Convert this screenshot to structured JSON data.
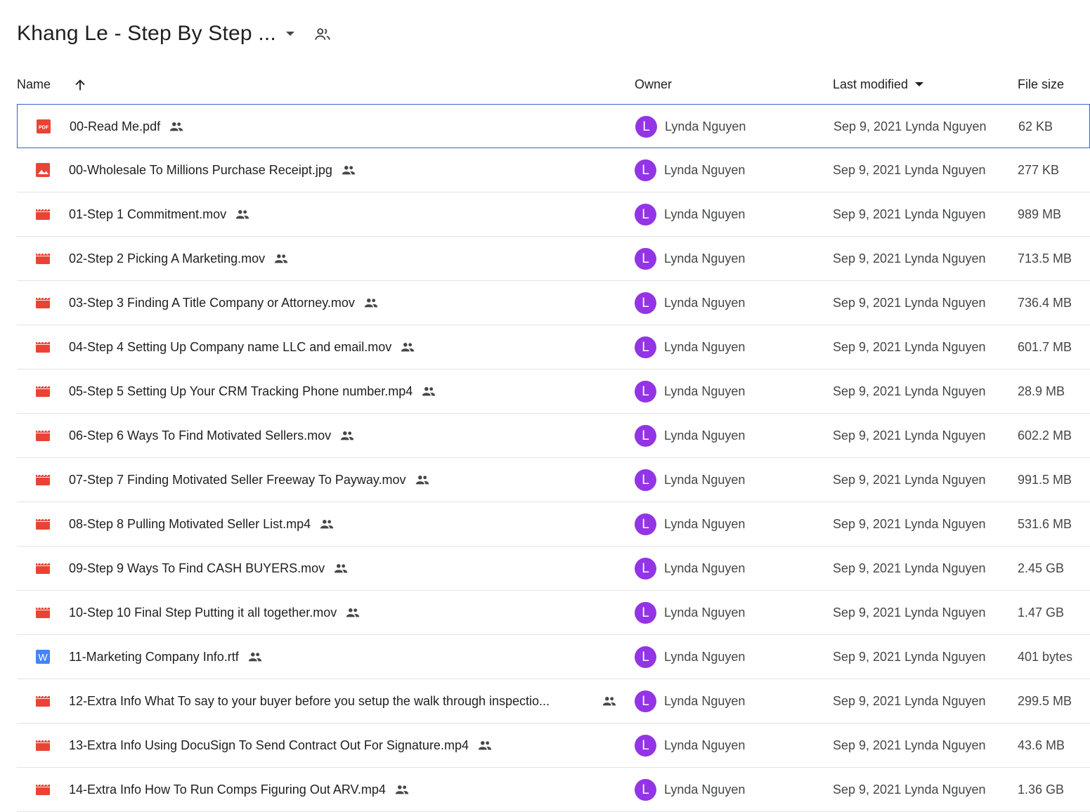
{
  "header": {
    "title": "Khang Le - Step By Step ...",
    "shared_icon": "people-icon",
    "dropdown_icon": "caret-down-icon"
  },
  "columns": {
    "name": "Name",
    "name_sort_icon": "arrow-up-icon",
    "owner": "Owner",
    "last_modified": "Last modified",
    "last_modified_sort_icon": "caret-down-icon",
    "file_size": "File size"
  },
  "colors": {
    "accent": "#3a5fd0",
    "avatar": "#9334e6",
    "file_red": "#ea4335",
    "doc_blue": "#4285f4"
  },
  "files": [
    {
      "icon": "pdf",
      "name": "00-Read Me.pdf",
      "owner": "Lynda Nguyen",
      "avatar": "L",
      "modified": "Sep 9, 2021 Lynda Nguyen",
      "size": "62 KB",
      "selected": true
    },
    {
      "icon": "image",
      "name": "00-Wholesale To Millions Purchase Receipt.jpg",
      "owner": "Lynda Nguyen",
      "avatar": "L",
      "modified": "Sep 9, 2021 Lynda Nguyen",
      "size": "277 KB"
    },
    {
      "icon": "video",
      "name": "01-Step 1 Commitment.mov",
      "owner": "Lynda Nguyen",
      "avatar": "L",
      "modified": "Sep 9, 2021 Lynda Nguyen",
      "size": "989 MB"
    },
    {
      "icon": "video",
      "name": "02-Step 2 Picking A Marketing.mov",
      "owner": "Lynda Nguyen",
      "avatar": "L",
      "modified": "Sep 9, 2021 Lynda Nguyen",
      "size": "713.5 MB"
    },
    {
      "icon": "video",
      "name": "03-Step 3 Finding A Title Company or Attorney.mov",
      "owner": "Lynda Nguyen",
      "avatar": "L",
      "modified": "Sep 9, 2021 Lynda Nguyen",
      "size": "736.4 MB"
    },
    {
      "icon": "video",
      "name": "04-Step 4 Setting Up Company name LLC and email.mov",
      "owner": "Lynda Nguyen",
      "avatar": "L",
      "modified": "Sep 9, 2021 Lynda Nguyen",
      "size": "601.7 MB"
    },
    {
      "icon": "video",
      "name": "05-Step 5 Setting Up Your CRM Tracking Phone number.mp4",
      "owner": "Lynda Nguyen",
      "avatar": "L",
      "modified": "Sep 9, 2021 Lynda Nguyen",
      "size": "28.9 MB"
    },
    {
      "icon": "video",
      "name": "06-Step 6 Ways To Find Motivated Sellers.mov",
      "owner": "Lynda Nguyen",
      "avatar": "L",
      "modified": "Sep 9, 2021 Lynda Nguyen",
      "size": "602.2 MB"
    },
    {
      "icon": "video",
      "name": "07-Step 7 Finding Motivated Seller Freeway To Payway.mov",
      "owner": "Lynda Nguyen",
      "avatar": "L",
      "modified": "Sep 9, 2021 Lynda Nguyen",
      "size": "991.5 MB"
    },
    {
      "icon": "video",
      "name": "08-Step 8 Pulling Motivated Seller List.mp4",
      "owner": "Lynda Nguyen",
      "avatar": "L",
      "modified": "Sep 9, 2021 Lynda Nguyen",
      "size": "531.6 MB"
    },
    {
      "icon": "video",
      "name": "09-Step 9 Ways To Find CASH BUYERS.mov",
      "owner": "Lynda Nguyen",
      "avatar": "L",
      "modified": "Sep 9, 2021 Lynda Nguyen",
      "size": "2.45 GB"
    },
    {
      "icon": "video",
      "name": "10-Step 10 Final Step Putting it all together.mov",
      "owner": "Lynda Nguyen",
      "avatar": "L",
      "modified": "Sep 9, 2021 Lynda Nguyen",
      "size": "1.47 GB"
    },
    {
      "icon": "word",
      "name": "11-Marketing Company Info.rtf",
      "owner": "Lynda Nguyen",
      "avatar": "L",
      "modified": "Sep 9, 2021 Lynda Nguyen",
      "size": "401 bytes"
    },
    {
      "icon": "video",
      "name": "12-Extra Info What To say to your buyer before you setup the walk through inspectio...",
      "owner": "Lynda Nguyen",
      "avatar": "L",
      "modified": "Sep 9, 2021 Lynda Nguyen",
      "size": "299.5 MB",
      "truncated": true
    },
    {
      "icon": "video",
      "name": "13-Extra Info Using DocuSign To Send Contract Out For Signature.mp4",
      "owner": "Lynda Nguyen",
      "avatar": "L",
      "modified": "Sep 9, 2021 Lynda Nguyen",
      "size": "43.6 MB"
    },
    {
      "icon": "video",
      "name": "14-Extra Info How To Run Comps Figuring Out ARV.mp4",
      "owner": "Lynda Nguyen",
      "avatar": "L",
      "modified": "Sep 9, 2021 Lynda Nguyen",
      "size": "1.36 GB"
    }
  ]
}
